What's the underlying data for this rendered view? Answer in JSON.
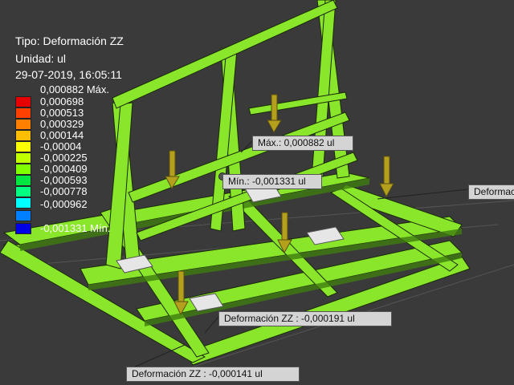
{
  "header": {
    "tipo": "Tipo: Deformación ZZ",
    "unidad": "Unidad: ul",
    "timestamp": "29-07-2019, 16:05:11"
  },
  "legend": {
    "items": [
      {
        "label": "0,000882 Máx.",
        "color": "#e60000"
      },
      {
        "label": "0,000698",
        "color": "#ff4000"
      },
      {
        "label": "0,000513",
        "color": "#ff8000"
      },
      {
        "label": "0,000329",
        "color": "#ffbf00"
      },
      {
        "label": "0,000144",
        "color": "#ffff00"
      },
      {
        "label": "-0,00004",
        "color": "#bfff00"
      },
      {
        "label": "-0,000225",
        "color": "#80ff00"
      },
      {
        "label": "-0,000409",
        "color": "#00e640"
      },
      {
        "label": "-0,000593",
        "color": "#00ff80"
      },
      {
        "label": "-0,000778",
        "color": "#00ffff"
      },
      {
        "label": "-0,000962",
        "color": "#0080ff"
      },
      {
        "label": "-0,001331 Mín.",
        "color": "#0000e6"
      }
    ]
  },
  "probes": {
    "max": "Máx.: 0,000882 ul",
    "min": "Mín.: -0,001331 ul",
    "p1": "Deformación ZZ : -0,000191 ul",
    "p2": "Deformación ZZ : -0,000141 ul",
    "p3": "Deformación ZZ"
  },
  "colors": {
    "model_green": "#8ae62a",
    "model_dark": "#3f7d10",
    "outline": "#1a2a08",
    "load_arrow": "#b5a01e",
    "background": "#3a3a3a"
  }
}
